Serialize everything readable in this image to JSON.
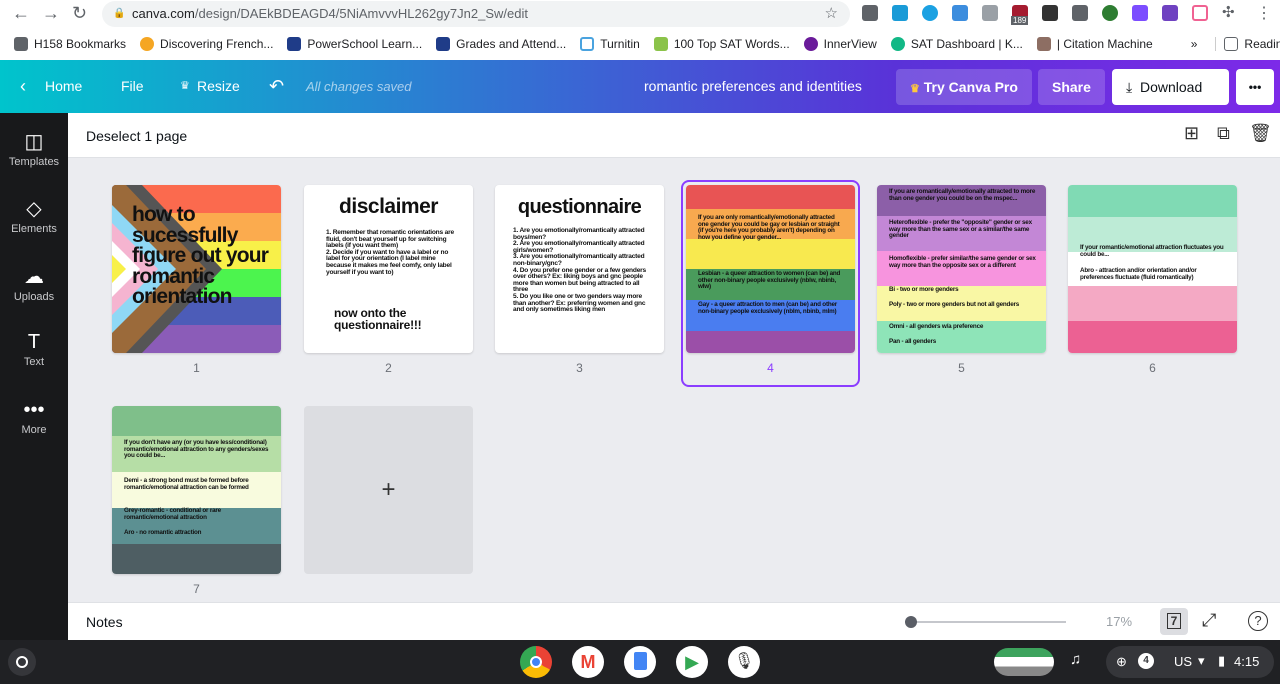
{
  "browser": {
    "url_host": "canva.com",
    "url_path": "/design/DAEkBDEAGD4/5NiAmvvvHL262gy7Jn2_Sw/edit",
    "ext_badge": "189",
    "bookmarks": [
      "H158 Bookmarks",
      "Discovering French...",
      "PowerSchool Learn...",
      "Grades and Attend...",
      "Turnitin",
      "100 Top SAT Words...",
      "InnerView",
      "SAT Dashboard | K...",
      "| Citation Machine"
    ],
    "more": "»",
    "reading_list": "Reading list"
  },
  "header": {
    "home": "Home",
    "file": "File",
    "resize": "Resize",
    "saved": "All changes saved",
    "title": "romantic preferences and identities",
    "try_pro": "Try Canva Pro",
    "share": "Share",
    "download": "Download",
    "more": "•••"
  },
  "sidebar": [
    {
      "label": "Templates"
    },
    {
      "label": "Elements"
    },
    {
      "label": "Uploads"
    },
    {
      "label": "Text"
    },
    {
      "label": "More"
    }
  ],
  "subheader": {
    "deselect": "Deselect 1 page"
  },
  "slides": [
    {
      "number": "1",
      "title": "how to sucessfully figure out your romantic orientation"
    },
    {
      "number": "2",
      "heading": "disclaimer",
      "items": [
        "1. Remember that romantic orientations are fluid, don't beat yourself up for switching labels (if you want them)",
        "2. Decide if you want to have a label or no label for your orientation (I label mine because it makes me feel comfy, only label yourself if you want to)"
      ],
      "footer": "now onto the questionnaire!!!"
    },
    {
      "number": "3",
      "heading": "questionnaire",
      "items": [
        "1. Are you emotionally/romantically attracted boys/men?",
        "2. Are you emotionally/romantically attracted girls/women?",
        "3. Are you emotionally/romantically attracted non-binary/gnc?",
        "4. Do you prefer one gender or a few genders over others? Ex: liking boys and gnc people more than women but being attracted to all three",
        "5. Do you like one or two genders way more than another? Ex: preferring women and gnc and only sometimes liking men"
      ]
    },
    {
      "number": "4",
      "texts": [
        "If you are only romantically/emotionally attracted one gender you could be gay or lesbian or straight (if you're here you probably aren't) depending on how you define your gender...",
        "Lesbian - a queer attraction to women (can be) and other non-binary people exclusively (nblw, nbinb, wlw)",
        "Gay - a queer attraction to men (can be) and other non-binary people exclusively (nblm, nbinb, mlm)"
      ]
    },
    {
      "number": "5",
      "texts": [
        "If you are romantically/emotionally attracted to more than one gender you could be on the mspec...",
        "Heteroflexible - prefer the \"opposite\" gender or sex way more than the same sex or a similar/the same gender",
        "Homoflexible - prefer similar/the same gender or sex way more than the opposite sex or a different",
        "Bi - two or more genders",
        "Poly - two or more genders but not all genders",
        "Omni - all genders w/a preference",
        "Pan - all genders"
      ]
    },
    {
      "number": "6",
      "texts": [
        "If your romantic/emotional attraction fluctuates you could be...",
        "Abro - attraction and/or orientation and/or preferences fluctuate (fluid romantically)"
      ]
    },
    {
      "number": "7",
      "texts": [
        "If you don't have any (or you have less/conditional) romantic/emotional attraction to any genders/sexes you could be...",
        "Demi - a strong bond must be formed before romantic/emotional attraction can be formed",
        "Grey-romantic - conditional or rare romantic/emotional attraction",
        "Aro - no romantic attraction"
      ]
    }
  ],
  "add_page": "+",
  "footer": {
    "notes": "Notes",
    "zoom": "17%",
    "page_count": "7",
    "help": "?",
    "zoom_fraction": 0.0
  },
  "shelf": {
    "locale": "US",
    "time": "4:15",
    "notif": "4"
  },
  "colors": {
    "accent": "#8b3dff"
  }
}
